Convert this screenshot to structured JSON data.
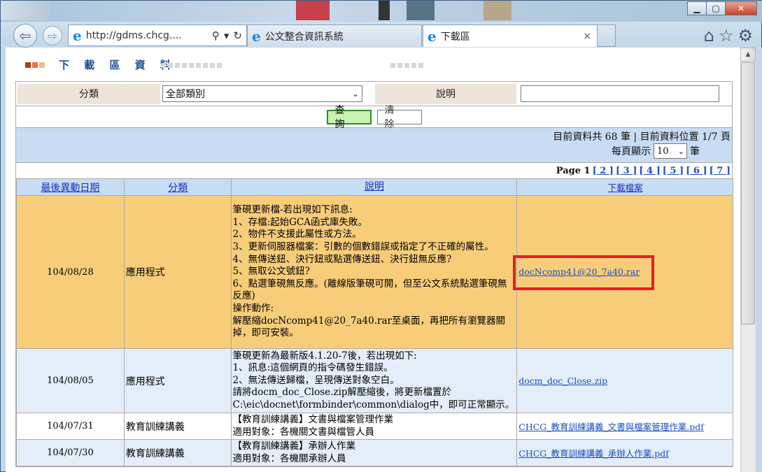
{
  "browser": {
    "address": "http://gdms.chcg....",
    "tabs": [
      {
        "label": "公文整合資訊系統"
      },
      {
        "label": "下載區"
      }
    ],
    "tab_close": "×"
  },
  "page": {
    "heading": "下 載 區 資 料"
  },
  "filter": {
    "category_label": "分類",
    "category_value": "全部類別",
    "description_label": "說明",
    "description_value": "",
    "query_button": "查 詢",
    "clear_button": "清 除"
  },
  "summary": {
    "total_text": "目前資料共 68 筆 | 目前資料位置 1/7 頁",
    "per_page_label": "每頁顯示",
    "per_page_value": "10",
    "per_page_unit": "筆"
  },
  "pager": {
    "label": "Page 1",
    "pages": [
      "[ 2 ]",
      "[ 3 ]",
      "[ 4 ]",
      "[ 5 ]",
      "[ 6 ]",
      "[ 7 ]"
    ]
  },
  "table": {
    "headers": [
      "最後異動日期",
      "分類",
      "說明",
      "下載檔案"
    ],
    "rows": [
      {
        "date": "104/08/28",
        "category": "應用程式",
        "description": "筆硯更新檔-若出現如下訊息:\n1、存檔:起始GCA函式庫失敗。\n2、物件不支援此屬性或方法。\n3、更新伺服器檔案：引數的個數錯誤或指定了不正確的屬性。\n4、無傳送鈕、決行鈕或點選傳送鈕、決行鈕無反應?\n5、無取公文號鈕?\n6、點選筆硯無反應。(離線版筆硯可開，但至公文系統點選筆硯無反應)\n操作動作:\n解壓縮docNcomp41@20_7a40.rar至桌面，再把所有瀏覽器關掉，即可安裝。",
        "file": "docNcomp41@20_7a40.rar"
      },
      {
        "date": "104/08/05",
        "category": "應用程式",
        "description": "筆硯更新為最新版4.1.20-7後，若出現如下:\n1、訊息:這個網頁的指令碼發生錯誤。\n2、無法傳送歸檔，呈現傳送對象空白。\n請將docm_doc_Close.zip解壓縮後，將更新檔置於C:\\eic\\docnet\\formbinder\\common\\dialog中，即可正常顯示。",
        "file": "docm_doc_Close.zip"
      },
      {
        "date": "104/07/31",
        "category": "教育訓練講義",
        "description": "【教育訓練講義】文書與檔案管理作業\n適用對象：各機關文書與檔管人員",
        "file": "CHCG_教育訓練講義_文書與檔案管理作業.pdf"
      },
      {
        "date": "104/07/30",
        "category": "教育訓練講義",
        "description": "【教育訓練講義】承辦人作業\n適用對象：各機關承辦人員",
        "file": "CHCG_教育訓練講義_承辦人作業.pdf"
      }
    ]
  },
  "colors": {
    "highlight_row": "#f8cd7a",
    "header_blue": "#c8dcf4",
    "annotation_red": "#e52020",
    "query_green": "#c9f2b3"
  }
}
